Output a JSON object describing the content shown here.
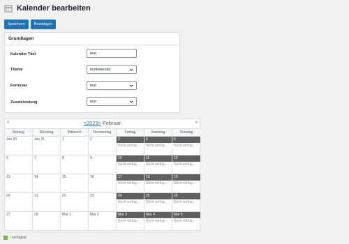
{
  "header": {
    "title": "Kalender bearbeiten",
    "icon": "calendar-icon"
  },
  "buttons": {
    "save": "Speichern",
    "confirm": "Bestätigen"
  },
  "panel": {
    "title": "Grundlagen",
    "fields": [
      {
        "label": "Kalender Titel",
        "value": "test",
        "type": "text"
      },
      {
        "label": "Theme",
        "value": "testkalender",
        "type": "select"
      },
      {
        "label": "Formular",
        "value": "test",
        "type": "select"
      },
      {
        "label": "Zusatzleistung",
        "value": "test",
        "type": "select"
      }
    ]
  },
  "calendar": {
    "prev": "<",
    "next": ">",
    "year_prev": "<",
    "year": "2023",
    "year_next": ">",
    "month": "Februar",
    "weekdays": [
      "Montag",
      "Dienstag",
      "Mittwoch",
      "Donnerstag",
      "Freitag",
      "Samstag",
      "Sonntag"
    ],
    "weeks": [
      [
        {
          "d": "Jan 30"
        },
        {
          "d": "Jan 31"
        },
        {
          "d": "1"
        },
        {
          "d": "2"
        },
        {
          "d": "3",
          "s": "Nicht verfüg..."
        },
        {
          "d": "4",
          "s": "Nicht verfüg..."
        },
        {
          "d": "5",
          "s": "Nicht verfüg..."
        }
      ],
      [
        {
          "d": "6"
        },
        {
          "d": "7"
        },
        {
          "d": "8"
        },
        {
          "d": "9"
        },
        {
          "d": "10",
          "s": "Nicht verfüg..."
        },
        {
          "d": "11",
          "s": "Nicht verfüg..."
        },
        {
          "d": "12",
          "s": "Nicht verfüg..."
        }
      ],
      [
        {
          "d": "13"
        },
        {
          "d": "14"
        },
        {
          "d": "15"
        },
        {
          "d": "16"
        },
        {
          "d": "17",
          "s": "Nicht verfüg..."
        },
        {
          "d": "18",
          "s": "Nicht verfüg..."
        },
        {
          "d": "19",
          "s": "Nicht verfüg..."
        }
      ],
      [
        {
          "d": "20"
        },
        {
          "d": "21"
        },
        {
          "d": "22"
        },
        {
          "d": "23"
        },
        {
          "d": "24",
          "s": "Nicht verfüg..."
        },
        {
          "d": "25",
          "s": "Nicht verfüg..."
        },
        {
          "d": "26",
          "s": "Nicht verfüg..."
        }
      ],
      [
        {
          "d": "27"
        },
        {
          "d": "28"
        },
        {
          "d": "Mar 1"
        },
        {
          "d": "Mar 2"
        },
        {
          "d": "Mar 3",
          "s": "Nicht verfüg..."
        },
        {
          "d": "Mar 4",
          "s": "Nicht verfüg..."
        },
        {
          "d": "Mar 5",
          "s": "Nicht verfüg..."
        }
      ]
    ]
  },
  "legend": {
    "label": "- verfügbar",
    "color": "#7ab648"
  },
  "colors": {
    "accent": "#2271b1",
    "blocked": "#5f5f5f"
  }
}
